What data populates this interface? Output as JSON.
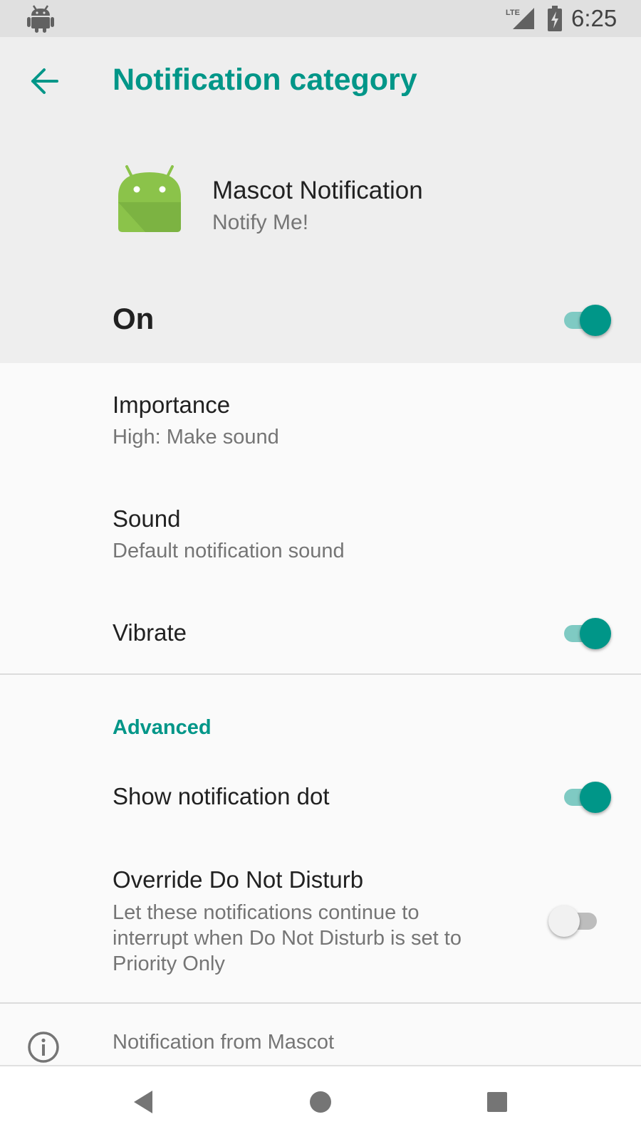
{
  "status_bar": {
    "time": "6:25",
    "network_label": "LTE",
    "icons": [
      "android-icon",
      "lte-signal-icon",
      "battery-charging-icon"
    ]
  },
  "header": {
    "title": "Notification category",
    "back_icon": "arrow-left-icon",
    "app": {
      "icon": "android-app-icon",
      "name": "Mascot Notification",
      "subtitle": "Notify Me!"
    },
    "master_toggle": {
      "label": "On",
      "checked": true
    }
  },
  "settings": [
    {
      "title": "Importance",
      "summary": "High: Make sound"
    },
    {
      "title": "Sound",
      "summary": "Default notification sound"
    },
    {
      "title": "Vibrate",
      "checked": true
    }
  ],
  "advanced": {
    "header": "Advanced",
    "items": [
      {
        "title": "Show notification dot",
        "checked": true
      },
      {
        "title": "Override Do Not Disturb",
        "summary_lines": [
          "Let these notifications continue to",
          "interrupt when Do Not Disturb is set to",
          "Priority Only"
        ],
        "checked": false
      }
    ]
  },
  "footer": {
    "icon": "info-icon",
    "text": "Notification from Mascot"
  },
  "nav_bar": {
    "icons": [
      "back-triangle-icon",
      "home-circle-icon",
      "recents-square-icon"
    ]
  },
  "colors": {
    "accent": "#009688",
    "accent_track": "#7fcac3",
    "header_bg": "#eeeeee",
    "body_bg": "#fafafa",
    "android_green": "#8bc34a"
  }
}
